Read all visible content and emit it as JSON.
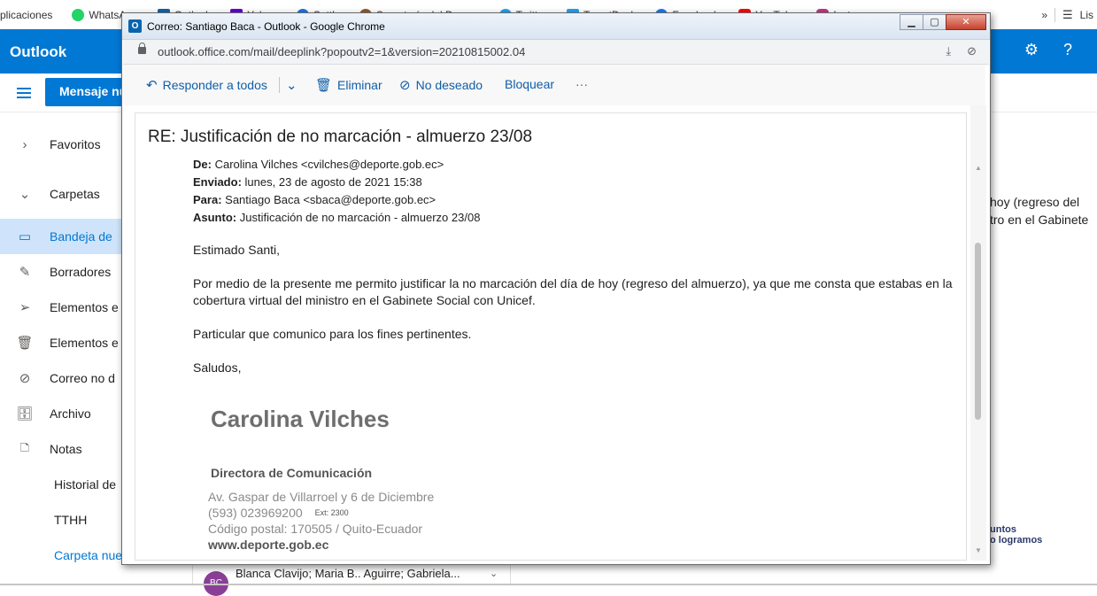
{
  "browser_bookmarks": {
    "items": [
      "plicaciones",
      "WhatsApp",
      "Outlook",
      "Yahoo",
      "Sattly",
      "Secretaría del Depo...",
      "Twitter",
      "TweetDeck",
      "Facebook",
      "YouTube",
      "Instagram"
    ],
    "overflow_label": "»",
    "reading_list_label": "Lis"
  },
  "outlook": {
    "brand": "Outlook",
    "new_message_label": "Mensaje nu",
    "nav": [
      {
        "label": "Favoritos",
        "icon": "chevron-right-icon",
        "kind": "section"
      },
      {
        "label": "Carpetas",
        "icon": "chevron-down-icon",
        "kind": "section"
      },
      {
        "label": "Bandeja de",
        "icon": "inbox-icon",
        "kind": "active"
      },
      {
        "label": "Borradores",
        "icon": "pencil-icon",
        "kind": "item"
      },
      {
        "label": "Elementos e",
        "icon": "send-icon",
        "kind": "item"
      },
      {
        "label": "Elementos e",
        "icon": "trash-icon",
        "kind": "item"
      },
      {
        "label": "Correo no d",
        "icon": "block-icon",
        "kind": "item"
      },
      {
        "label": "Archivo",
        "icon": "archive-icon",
        "kind": "item"
      },
      {
        "label": "Notas",
        "icon": "note-icon",
        "kind": "item"
      },
      {
        "label": "Historial de",
        "icon": "",
        "kind": "plain"
      },
      {
        "label": "TTHH",
        "icon": "",
        "kind": "plain"
      },
      {
        "label": "Carpeta nue",
        "icon": "",
        "kind": "link"
      }
    ],
    "right_text_line1": "hoy (regreso del",
    "right_text_line2": "tro en el Gabinete",
    "right_logo_line1": "untos",
    "right_logo_line2": "o logramos",
    "bottom_avatar": "BC",
    "bottom_recipients": "Blanca Clavijo; Maria B.. Aguirre; Gabriela..."
  },
  "popup": {
    "window_title": "Correo: Santiago Baca - Outlook - Google Chrome",
    "app_icon_letter": "O",
    "url": "outlook.office.com/mail/deeplink?popoutv2=1&version=20210815002.04",
    "toolbar": {
      "reply_all": "Responder a todos",
      "delete": "Eliminar",
      "junk": "No deseado",
      "block": "Bloquear",
      "more": "···"
    },
    "message": {
      "subject": "RE: Justificación de no marcación - almuerzo 23/08",
      "from_label": "De:",
      "from_value": "Carolina Vilches <cvilches@deporte.gob.ec>",
      "sent_label": "Enviado:",
      "sent_value": "lunes, 23 de agosto de 2021 15:38",
      "to_label": "Para:",
      "to_value": "Santiago Baca <sbaca@deporte.gob.ec>",
      "subject_label": "Asunto:",
      "subject_value": "Justificación de no marcación - almuerzo 23/08",
      "greeting": "Estimado Santi,",
      "paragraph1": "Por medio de la presente me permito justificar la no marcación del día de hoy (regreso del almuerzo), ya que me consta que estabas en la cobertura virtual del ministro en el Gabinete Social con Unicef.",
      "paragraph2": "Particular que comunico para los fines pertinentes.",
      "closing": "Saludos,",
      "signature": {
        "name": "Carolina Vilches",
        "role": "Directora de Comunicación",
        "address": "Av. Gaspar de Villarroel y 6 de Diciembre",
        "phone": "(593) 023969200",
        "ext": "Ext: 2300",
        "postal": "Código postal: 170505 / Quito-Ecuador",
        "web": "www.deporte.gob.ec"
      }
    }
  }
}
